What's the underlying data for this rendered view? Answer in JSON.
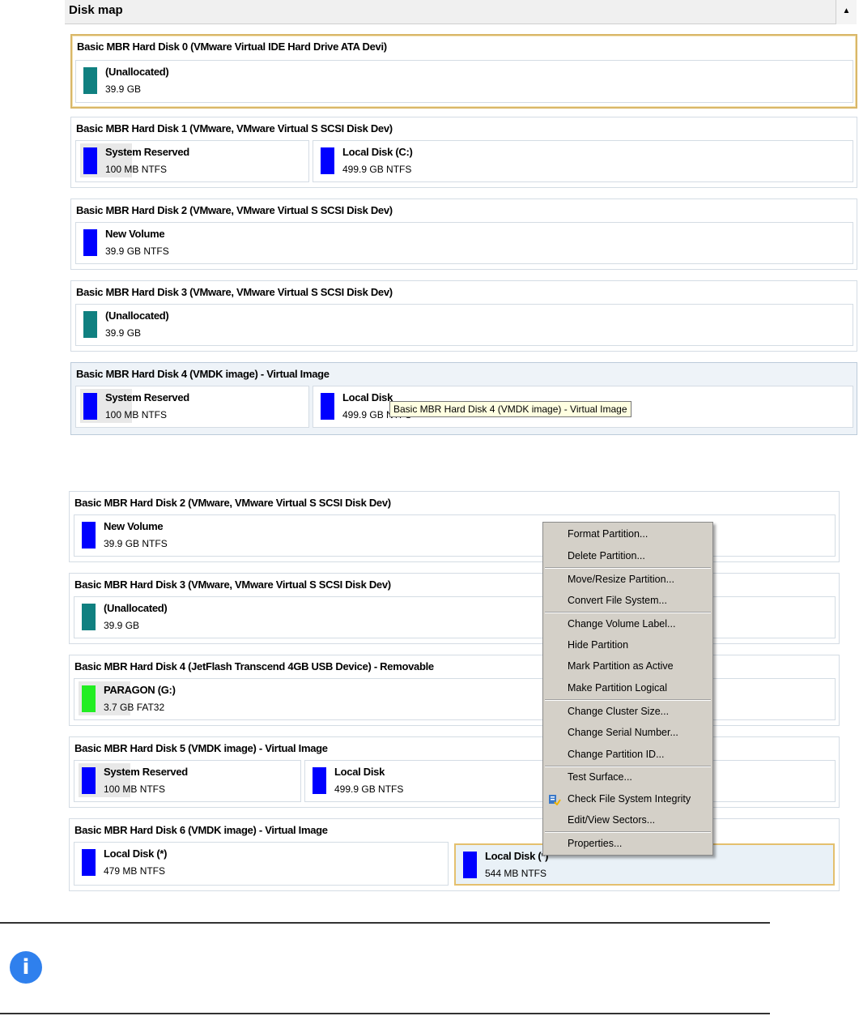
{
  "header": {
    "title": "Disk map",
    "collapse_glyph": "▲"
  },
  "top_disks": [
    {
      "title": "Basic MBR Hard Disk 0 (VMware Virtual IDE Hard Drive ATA Devi)",
      "partitions": [
        {
          "name": "(Unallocated)",
          "info": "39.9 GB",
          "color": "#108080"
        }
      ]
    },
    {
      "title": "Basic MBR Hard Disk 1 (VMware, VMware Virtual S SCSI Disk Dev)",
      "partitions": [
        {
          "name": "System Reserved",
          "info": "100 MB NTFS",
          "color": "#0000ff"
        },
        {
          "name": "Local Disk (C:)",
          "info": "499.9 GB NTFS",
          "color": "#0000ff"
        }
      ]
    },
    {
      "title": "Basic MBR Hard Disk 2 (VMware, VMware Virtual S SCSI Disk Dev)",
      "partitions": [
        {
          "name": "New Volume",
          "info": "39.9 GB NTFS",
          "color": "#0000ff"
        }
      ]
    },
    {
      "title": "Basic MBR Hard Disk 3 (VMware, VMware Virtual S SCSI Disk Dev)",
      "partitions": [
        {
          "name": "(Unallocated)",
          "info": "39.9 GB",
          "color": "#108080"
        }
      ]
    },
    {
      "title": "Basic MBR Hard Disk 4 (VMDK image) - Virtual Image",
      "partitions": [
        {
          "name": "System Reserved",
          "info": "100 MB NTFS",
          "color": "#0000ff"
        },
        {
          "name": "Local Disk",
          "info": "499.9 GB NTFS",
          "color": "#0000ff"
        }
      ]
    }
  ],
  "tooltip": "Basic MBR Hard Disk 4 (VMDK image) - Virtual Image",
  "bottom_disks": [
    {
      "title": "Basic MBR Hard Disk 2 (VMware, VMware Virtual S SCSI Disk Dev)",
      "partitions": [
        {
          "name": "New Volume",
          "info": "39.9 GB NTFS",
          "color": "#0000ff"
        }
      ]
    },
    {
      "title": "Basic MBR Hard Disk 3 (VMware, VMware Virtual S SCSI Disk Dev)",
      "partitions": [
        {
          "name": "(Unallocated)",
          "info": "39.9 GB",
          "color": "#108080"
        }
      ]
    },
    {
      "title": "Basic MBR Hard Disk 4 (JetFlash Transcend 4GB USB Device) - Removable",
      "partitions": [
        {
          "name": "PARAGON (G:)",
          "info": "3.7 GB FAT32",
          "color": "#22ee22"
        }
      ]
    },
    {
      "title": "Basic MBR Hard Disk 5 (VMDK image) - Virtual Image",
      "partitions": [
        {
          "name": "System Reserved",
          "info": "100 MB NTFS",
          "color": "#0000ff"
        },
        {
          "name": "Local Disk",
          "info": "499.9 GB NTFS",
          "color": "#0000ff"
        }
      ]
    },
    {
      "title": "Basic MBR Hard Disk 6 (VMDK image) - Virtual Image",
      "partitions": [
        {
          "name": "Local Disk (*)",
          "info": "479 MB NTFS",
          "color": "#0000ff"
        },
        {
          "name": "Local Disk (*)",
          "info": "544 MB NTFS",
          "color": "#0000ff"
        }
      ]
    }
  ],
  "context_menu": {
    "items": [
      "Format Partition...",
      "Delete Partition...",
      "Move/Resize Partition...",
      "Convert File System...",
      "Change Volume Label...",
      "Hide Partition",
      "Mark Partition as Active",
      "Make Partition Logical",
      "Change Cluster Size...",
      "Change Serial Number...",
      "Change Partition ID...",
      "Test Surface...",
      "Check File System Integrity",
      "Edit/View Sectors...",
      "Properties..."
    ],
    "icon_item": "check-file-system-icon"
  },
  "note_icon": "i"
}
